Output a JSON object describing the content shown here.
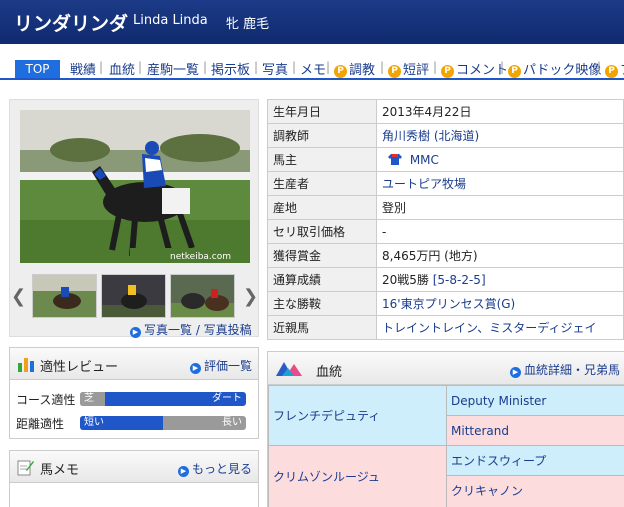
{
  "header": {
    "name": "リンダリンダ",
    "english": "Linda Linda",
    "sex_color": "牝 鹿毛"
  },
  "nav": {
    "top": "TOP",
    "items": [
      "戦績",
      "血統",
      "産駒一覧",
      "掲示板",
      "写真",
      "メモ",
      "調教",
      "短評",
      "コメント",
      "パドック映像",
      "プ"
    ],
    "premium_badge": "P"
  },
  "photos": {
    "watermark": "netkeiba.com",
    "links": "写真一覧 / 写真投稿",
    "prev": "❮",
    "next": "❯"
  },
  "review": {
    "title": "適性レビュー",
    "more": "評価一覧",
    "course_label": "コース適性",
    "course_left": "芝",
    "course_right": "ダート",
    "course_value": 0.85,
    "distance_label": "距離適性",
    "distance_left": "短い",
    "distance_right": "長い",
    "distance_value": 0.5
  },
  "memo": {
    "title": "馬メモ",
    "more": "もっと見る"
  },
  "profile": [
    {
      "key": "生年月日",
      "value": "2013年4月22日"
    },
    {
      "key": "調教師",
      "value": "角川秀樹 (北海道)"
    },
    {
      "key": "馬主",
      "value": "MMC"
    },
    {
      "key": "生産者",
      "value": "ユートピア牧場"
    },
    {
      "key": "産地",
      "value": "登別"
    },
    {
      "key": "セリ取引価格",
      "value": "-"
    },
    {
      "key": "獲得賞金",
      "value": "8,465万円 (地方)"
    },
    {
      "key": "通算成績",
      "value": "20戦5勝 ",
      "value2": "[5-8-2-5]"
    },
    {
      "key": "主な勝鞍",
      "value": "16'東京プリンセス賞(G)"
    },
    {
      "key": "近親馬",
      "value": "トレイントレイン、ミスターディジェイ"
    }
  ],
  "pedigree": {
    "title": "血統",
    "more": "血統詳細・兄弟馬",
    "sire": "フレンチデピュティ",
    "sire_sire": "Deputy Minister",
    "sire_dam": "Mitterand",
    "dam": "クリムゾンルージュ",
    "dam_sire": "エンドスウィープ",
    "dam_dam": "クリキャノン",
    "colors": {
      "male": "#cdeefa",
      "female": "#fcdcdc"
    }
  }
}
